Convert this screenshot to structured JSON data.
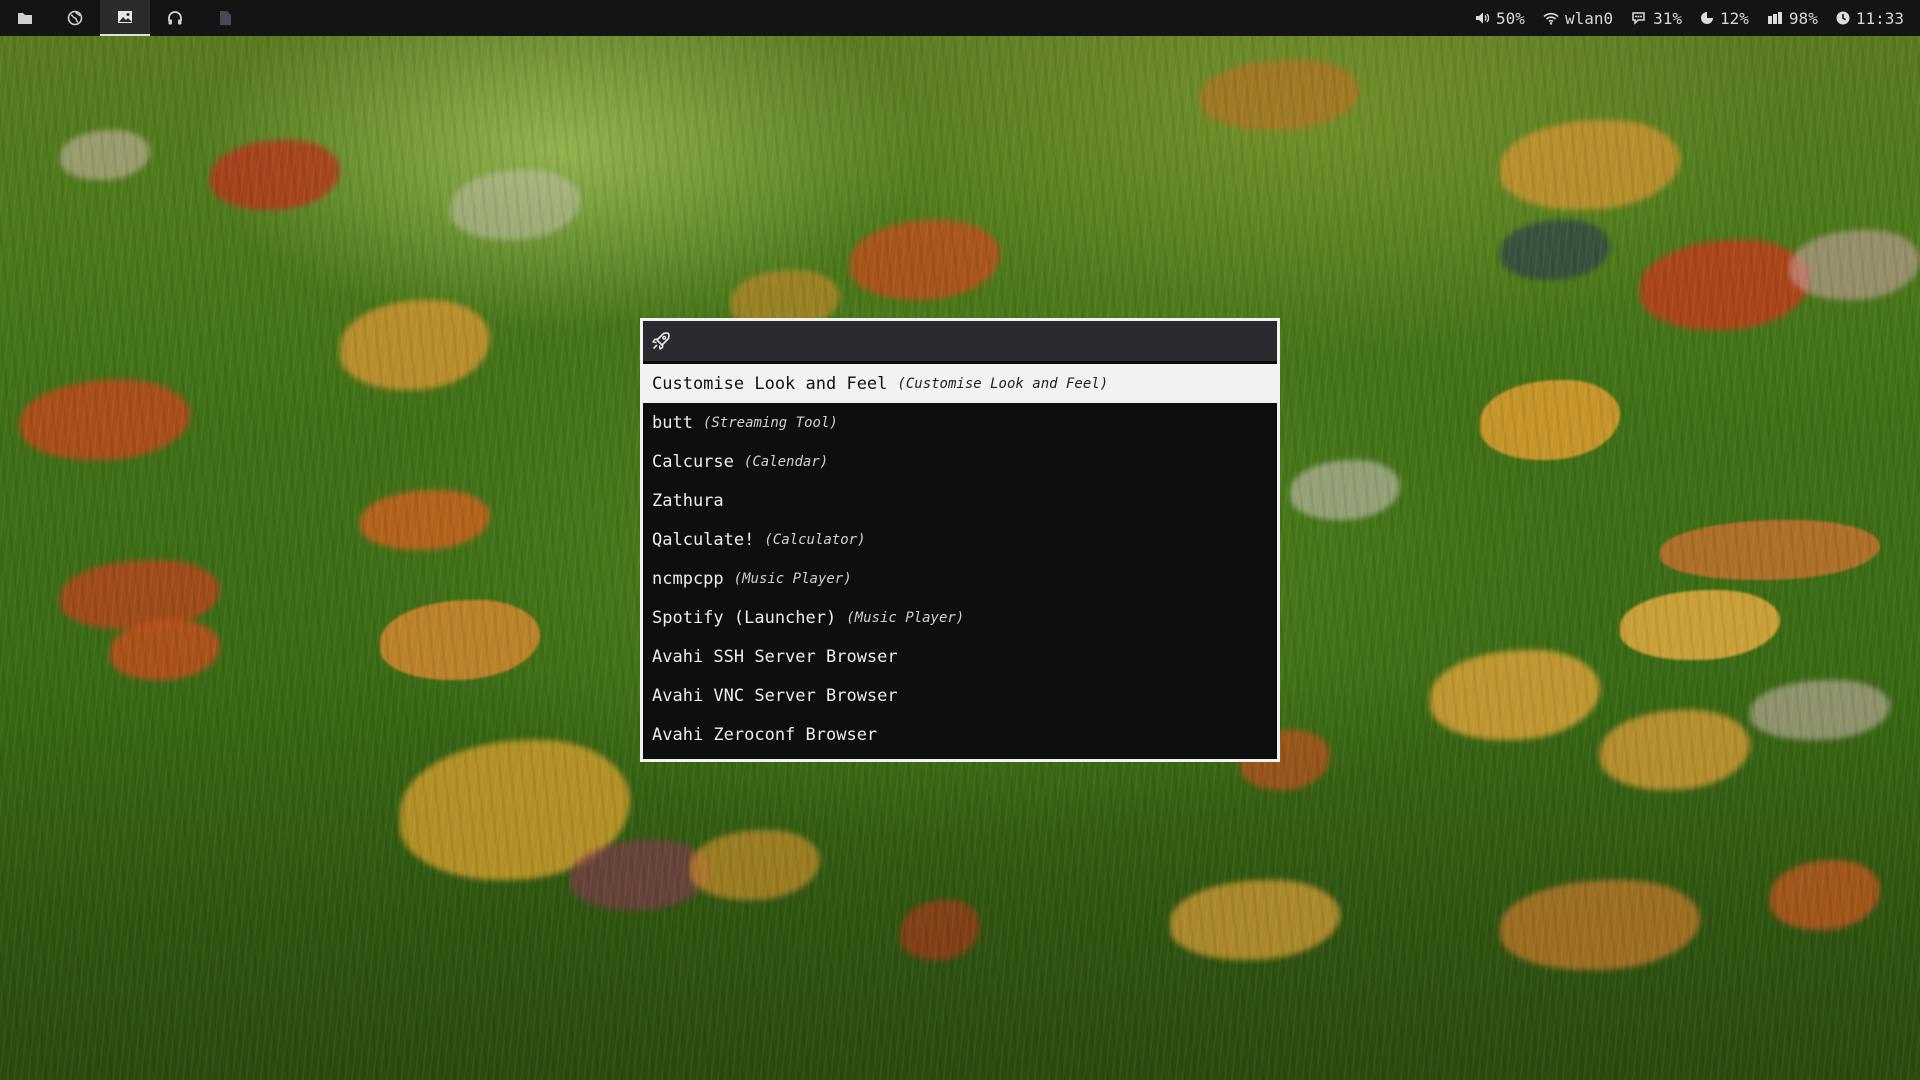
{
  "colors": {
    "bar_background": "#141414",
    "launcher_background": "#0e0e0e",
    "launcher_border": "#f2f2f2",
    "prompt_background": "#2a2a30",
    "selected_background": "#f2f2f2"
  },
  "topbar": {
    "workspaces": [
      {
        "icon": "folder-icon",
        "active": false
      },
      {
        "icon": "globe-icon",
        "active": false
      },
      {
        "icon": "image-icon",
        "active": true
      },
      {
        "icon": "headphones-icon",
        "active": false
      },
      {
        "icon": "document-icon",
        "active": false
      }
    ],
    "status": {
      "volume": "50%",
      "network": "wlan0",
      "cpu": "31%",
      "memory": "12%",
      "battery": "98%",
      "time": "11:33"
    }
  },
  "launcher": {
    "prompt_icon": "rocket-icon",
    "query": "",
    "items": [
      {
        "name": "Customise Look and Feel",
        "generic": "(Customise Look and Feel)",
        "selected": true
      },
      {
        "name": "butt",
        "generic": "(Streaming Tool)"
      },
      {
        "name": "Calcurse",
        "generic": "(Calendar)"
      },
      {
        "name": "Zathura",
        "generic": ""
      },
      {
        "name": "Qalculate!",
        "generic": "(Calculator)"
      },
      {
        "name": "ncmpcpp",
        "generic": "(Music Player)"
      },
      {
        "name": "Spotify (Launcher)",
        "generic": "(Music Player)"
      },
      {
        "name": "Avahi SSH Server Browser",
        "generic": ""
      },
      {
        "name": "Avahi VNC Server Browser",
        "generic": ""
      },
      {
        "name": "Avahi Zeroconf Browser",
        "generic": ""
      }
    ]
  }
}
